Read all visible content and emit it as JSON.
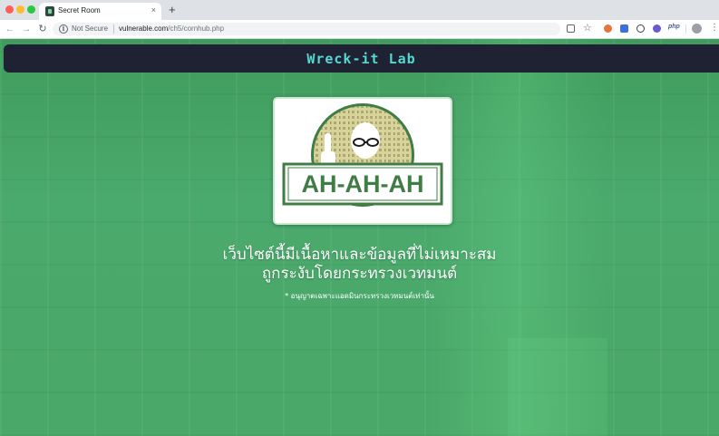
{
  "browser": {
    "tab_title": "Secret Room",
    "tab_close_glyph": "×",
    "new_tab_glyph": "+",
    "security_label": "Not Secure",
    "url_host": "vulnerable.com",
    "url_path": "/ch5/cornhub.php",
    "extension_php_label": "php",
    "nav_icons": [
      "back-arrow-icon",
      "forward-arrow-icon",
      "reload-icon"
    ],
    "toolbar_icons": [
      "translate-icon",
      "bookmark-star-icon",
      "orange-extension-icon",
      "blue-extension-icon",
      "ring-extension-icon",
      "purple-extension-icon",
      "php-extension-icon",
      "profile-avatar-icon",
      "menu-kebab-icon"
    ]
  },
  "page": {
    "header_title": "Wreck-it Lab",
    "logo_text": "AH-AH-AH",
    "headline_line1": "เว็บไซต์นี้มีเนื้อหาและข้อมูลที่ไม่เหมาะสม",
    "headline_line2": "ถูกระงับโดยกระทรวงเวทมนต์",
    "subnote": "* อนุญาตเฉพาะแอดมินกระทรวงเวทมนต์เท่านั้น"
  },
  "colors": {
    "page_green": "#4aa56a",
    "header_bg": "#1e2233",
    "header_text": "#56d9d3",
    "logo_green": "#3f7d45",
    "logo_gold": "#d8d39a"
  }
}
